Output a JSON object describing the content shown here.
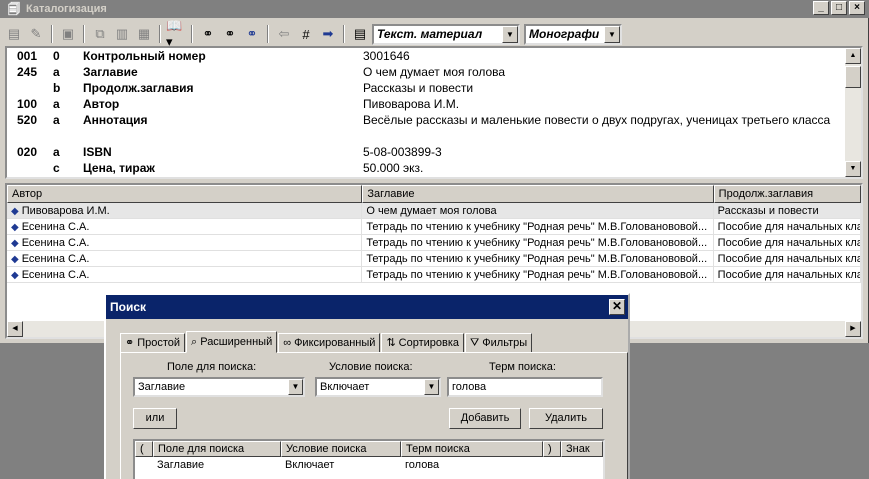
{
  "window": {
    "title": "Каталогизация"
  },
  "toolbar": {
    "doc_type": "Текст. материал",
    "biblio_level": "Монографи"
  },
  "marc": [
    {
      "tag": "001",
      "sub": "0",
      "name": "Контрольный номер",
      "value": "3001646"
    },
    {
      "tag": "245",
      "sub": "a",
      "name": "Заглавие",
      "value": "О чем думает моя голова"
    },
    {
      "tag": "",
      "sub": "b",
      "name": "Продолж.заглавия",
      "value": "Рассказы и повести"
    },
    {
      "tag": "100",
      "sub": "a",
      "name": "Автор",
      "value": "Пивоварова И.М."
    },
    {
      "tag": "520",
      "sub": "a",
      "name": "Аннотация",
      "value": "Весёлые рассказы и маленькие повести о двух подругах, ученицах третьего класса"
    },
    {
      "tag": "020",
      "sub": "a",
      "name": "ISBN",
      "value": "5-08-003899-3"
    },
    {
      "tag": "",
      "sub": "c",
      "name": "Цена, тираж",
      "value": "50.000 экз."
    }
  ],
  "list": {
    "headers": [
      "Автор",
      "Заглавие",
      "Продолж.заглавия"
    ],
    "rows": [
      [
        "Пивоварова И.М.",
        "О чем думает моя голова",
        "Рассказы и повести"
      ],
      [
        "Есенина С.А.",
        "Тетрадь по чтению к учебнику \"Родная речь\" М.В.Голованововой...",
        "Пособие для начальных кла"
      ],
      [
        "Есенина С.А.",
        "Тетрадь по чтению к учебнику \"Родная речь\" М.В.Голованововой...",
        "Пособие для начальных кла"
      ],
      [
        "Есенина С.А.",
        "Тетрадь по чтению к учебнику \"Родная речь\" М.В.Голованововой...",
        "Пособие для начальных кла"
      ],
      [
        "Есенина С.А.",
        "Тетрадь по чтению к учебнику \"Родная речь\" М.В.Голованововой...",
        "Пособие для начальных кла"
      ]
    ]
  },
  "dialog": {
    "title": "Поиск",
    "tabs": [
      "Простой",
      "Расширенный",
      "Фиксированный",
      "Сортировка",
      "Фильтры"
    ],
    "field_label": "Поле для поиска:",
    "cond_label": "Условие поиска:",
    "term_label": "Терм поиска:",
    "field_value": "Заглавие",
    "cond_value": "Включает",
    "term_value": "голова",
    "or_button": "или",
    "add_button": "Добавить",
    "delete_button": "Удалить",
    "grid_headers": [
      "(",
      "Поле для поиска",
      "Условие поиска",
      "Терм поиска",
      ")",
      "Знак"
    ],
    "grid_row": [
      "",
      "Заглавие",
      "Включает",
      "голова",
      "",
      ""
    ]
  }
}
